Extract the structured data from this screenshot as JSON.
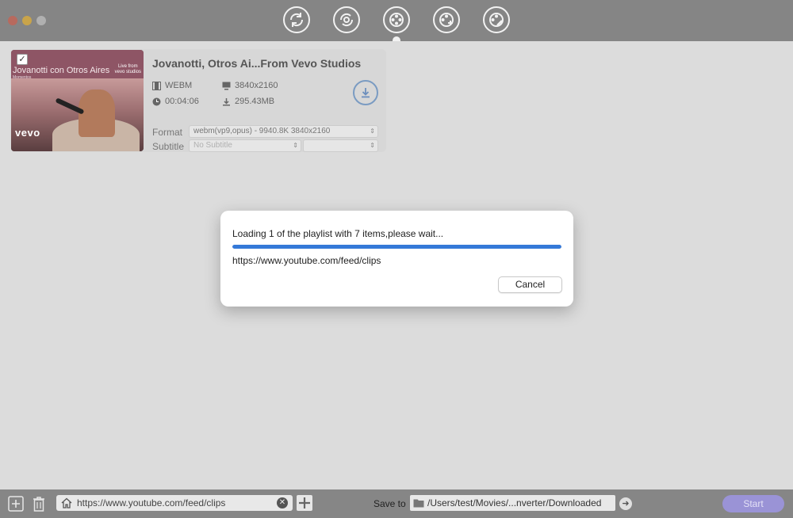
{
  "toolbar": {
    "modes": [
      {
        "icon": "convert-icon"
      },
      {
        "icon": "convert-settings-icon"
      },
      {
        "icon": "film-reel-icon"
      },
      {
        "icon": "film-reel-add-icon"
      },
      {
        "icon": "film-reel-edit-icon"
      }
    ]
  },
  "item": {
    "title": "Jovanotti, Otros Ai...From Vevo Studios",
    "checked": true,
    "thumbnail": {
      "title": "Jovanotti con Otros Aires",
      "subtitle": "Momentos",
      "badge_line1": "Live from",
      "badge_line2": "vevo studios",
      "logo": "vevo"
    },
    "container": "WEBM",
    "resolution": "3840x2160",
    "duration": "00:04:06",
    "size": "295.43MB",
    "format_label": "Format",
    "format_value": "webm(vp9,opus) - 9940.8K 3840x2160",
    "subtitle_label": "Subtitle",
    "subtitle_value": "No Subtitle",
    "subtitle_value2": ""
  },
  "dialog": {
    "message": "Loading 1 of the playlist with 7 items,please wait...",
    "progress": 1.0,
    "url": "https://www.youtube.com/feed/clips",
    "cancel_label": "Cancel"
  },
  "bottom": {
    "url_value": "https://www.youtube.com/feed/clips",
    "save_to_label": "Save to",
    "save_path": "/Users/test/Movies/...nverter/Downloaded",
    "start_label": "Start"
  },
  "colors": {
    "accent": "#3479d8",
    "start": "#9a93d6"
  }
}
